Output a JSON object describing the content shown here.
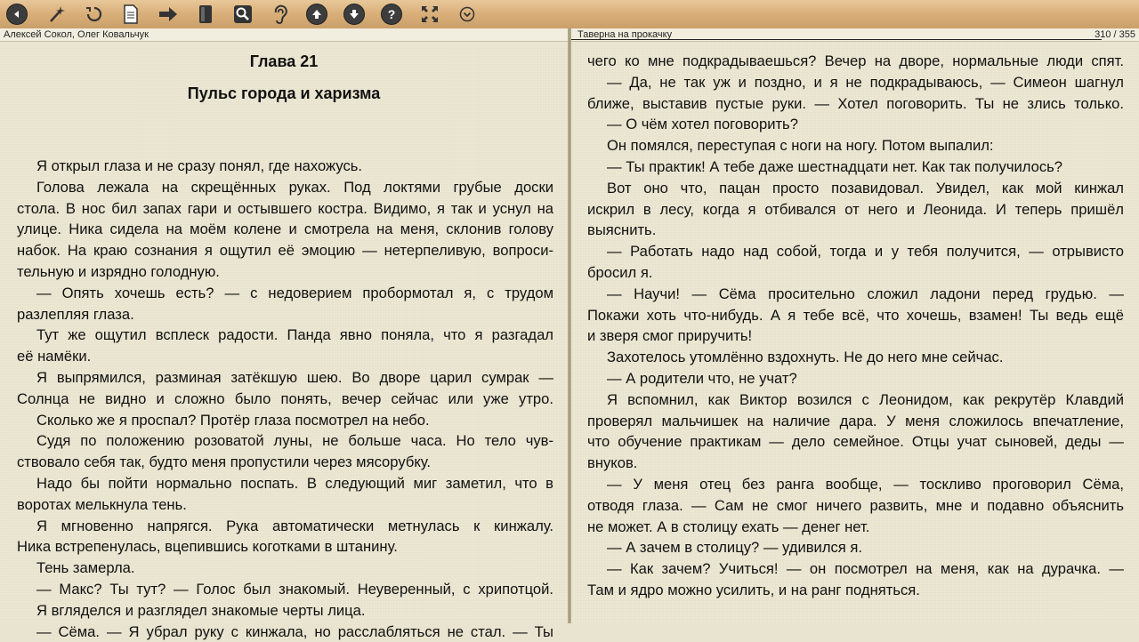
{
  "toolbar": {
    "buttons": [
      {
        "name": "back-icon"
      },
      {
        "name": "magic-wand-icon"
      },
      {
        "name": "refresh-icon"
      },
      {
        "name": "document-icon"
      },
      {
        "name": "arrow-right-icon"
      },
      {
        "name": "book-icon"
      },
      {
        "name": "search-icon"
      },
      {
        "name": "ear-icon"
      },
      {
        "name": "arrow-up-icon"
      },
      {
        "name": "arrow-down-icon"
      },
      {
        "name": "help-icon"
      },
      {
        "name": "fullscreen-icon"
      },
      {
        "name": "chevron-down-icon"
      }
    ]
  },
  "header": {
    "author": "Алексей  Сокол, Олег  Ковальчук",
    "book_title": "Таверна на прокачку",
    "page_counter": "310 / 355"
  },
  "left_page": {
    "chapter": "Глава 21",
    "subtitle": "Пульс города и харизма",
    "lines": [
      {
        "t": "Я открыл глаза и не сразу понял, где нахожусь.",
        "ind": true,
        "j": false
      },
      {
        "t": "Голова лежала на скрещённых руках. Под локтями грубые доски",
        "ind": true,
        "j": true
      },
      {
        "t": "стола. В нос бил запах гари и остывшего костра. Видимо, я так и уснул на",
        "ind": false,
        "j": true
      },
      {
        "t": "улице. Ника сидела на моём колене и смотрела на меня, склонив голову",
        "ind": false,
        "j": true
      },
      {
        "t": "набок. На краю сознания я ощутил её эмоцию — нетерпеливую, вопроси-",
        "ind": false,
        "j": true
      },
      {
        "t": "тельную и изрядно голодную.",
        "ind": false,
        "j": false
      },
      {
        "t": "— Опять хочешь есть? — с недоверием пробормотал я, с трудом",
        "ind": true,
        "j": true
      },
      {
        "t": "разлепляя глаза.",
        "ind": false,
        "j": false
      },
      {
        "t": "Тут же ощутил всплеск радости. Панда явно поняла, что я разгадал",
        "ind": true,
        "j": true
      },
      {
        "t": "её намёки.",
        "ind": false,
        "j": false
      },
      {
        "t": "Я выпрямился, разминая затёкшую шею. Во дворе царил сумрак —",
        "ind": true,
        "j": true
      },
      {
        "t": "Солнца не видно и сложно было понять, вечер сейчас или уже утро.",
        "ind": false,
        "j": true
      },
      {
        "t": "Сколько же я проспал? Протёр глаза посмотрел на небо.",
        "ind": true,
        "j": false
      },
      {
        "t": "Судя по положению розоватой луны, не больше часа. Но тело чув-",
        "ind": true,
        "j": true
      },
      {
        "t": "ствовало себя так, будто меня пропустили через мясорубку.",
        "ind": false,
        "j": false
      },
      {
        "t": "Надо бы пойти нормально поспать. В следующий миг заметил, что в",
        "ind": true,
        "j": true
      },
      {
        "t": "воротах мелькнула тень.",
        "ind": false,
        "j": false
      },
      {
        "t": "Я мгновенно напрягся. Рука автоматически метнулась к кинжалу.",
        "ind": true,
        "j": true
      },
      {
        "t": "Ника встрепенулась, вцепившись коготками в штанину.",
        "ind": false,
        "j": false
      },
      {
        "t": "Тень замерла.",
        "ind": true,
        "j": false
      },
      {
        "t": "— Макс? Ты тут? — Голос был знакомый. Неуверенный, с хрипотцой.",
        "ind": true,
        "j": true
      },
      {
        "t": "Я вгляделся и разглядел знакомые черты лица.",
        "ind": true,
        "j": false
      },
      {
        "t": "— Сёма. — Я убрал руку с кинжала, но расслабляться не стал. — Ты",
        "ind": true,
        "j": true
      }
    ]
  },
  "right_page": {
    "lines": [
      {
        "t": "чего ко мне подкрадываешься? Вечер на дворе, нормальные люди спят.",
        "ind": false,
        "j": true
      },
      {
        "t": "— Да, не так уж и поздно, и я не подкрадываюсь, — Симеон шагнул",
        "ind": true,
        "j": true
      },
      {
        "t": "ближе, выставив пустые руки. — Хотел поговорить. Ты не злись только.",
        "ind": false,
        "j": true
      },
      {
        "t": "— О чём хотел поговорить?",
        "ind": true,
        "j": false
      },
      {
        "t": "Он помялся, переступая с ноги на ногу. Потом выпалил:",
        "ind": true,
        "j": false
      },
      {
        "t": "— Ты практик! А тебе даже шестнадцати нет. Как так получилось?",
        "ind": true,
        "j": false
      },
      {
        "t": "Вот оно что, пацан просто позавидовал. Увидел, как мой кинжал",
        "ind": true,
        "j": true
      },
      {
        "t": "искрил в лесу, когда я отбивался от него и Леонида. И теперь пришёл",
        "ind": false,
        "j": true
      },
      {
        "t": "выяснить.",
        "ind": false,
        "j": false
      },
      {
        "t": "— Работать надо над собой, тогда и у тебя получится, — отрывисто",
        "ind": true,
        "j": true
      },
      {
        "t": "бросил я.",
        "ind": false,
        "j": false
      },
      {
        "t": "— Научи! — Сёма просительно сложил ладони перед грудью. —",
        "ind": true,
        "j": true
      },
      {
        "t": "Покажи хоть что-нибудь. А я тебе всё, что хочешь, взамен! Ты ведь ещё",
        "ind": false,
        "j": true
      },
      {
        "t": "и зверя смог приручить!",
        "ind": false,
        "j": false
      },
      {
        "t": "Захотелось утомлённо вздохнуть. Не до него мне сейчас.",
        "ind": true,
        "j": false
      },
      {
        "t": "— А родители что, не учат?",
        "ind": true,
        "j": false
      },
      {
        "t": "Я вспомнил, как Виктор возился с Леонидом, как рекрутёр Клавдий",
        "ind": true,
        "j": true
      },
      {
        "t": "проверял мальчишек на наличие дара. У меня сложилось впечатление,",
        "ind": false,
        "j": true
      },
      {
        "t": "что обучение практикам — дело семейное. Отцы учат сыновей, деды —",
        "ind": false,
        "j": true
      },
      {
        "t": "внуков.",
        "ind": false,
        "j": false
      },
      {
        "t": "— У меня отец без ранга вообще, — тоскливо проговорил Сёма,",
        "ind": true,
        "j": true
      },
      {
        "t": "отводя глаза. — Сам не смог ничего развить, мне и подавно объяснить",
        "ind": false,
        "j": true
      },
      {
        "t": "не может. А в столицу ехать — денег нет.",
        "ind": false,
        "j": false
      },
      {
        "t": "— А зачем в столицу? — удивился я.",
        "ind": true,
        "j": false
      },
      {
        "t": "— Как зачем? Учиться! — он посмотрел на меня, как на дурачка. —",
        "ind": true,
        "j": true
      },
      {
        "t": "Там и ядро можно усилить, и на ранг подняться.",
        "ind": false,
        "j": false
      }
    ]
  }
}
